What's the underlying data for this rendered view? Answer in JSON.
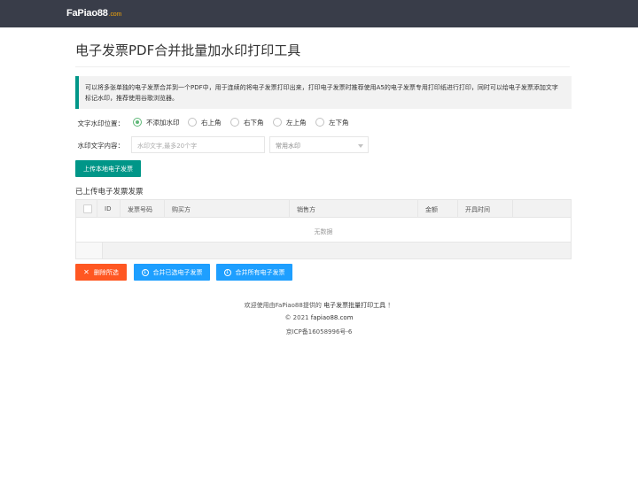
{
  "header": {
    "logo_main": "FaPiao88",
    "logo_domain": ".com"
  },
  "page": {
    "title": "电子发票PDF合并批量加水印打印工具"
  },
  "notice": {
    "text": "可以将多张单独的电子发票合并到一个PDF中，用于连续的将电子发票打印出来，打印电子发票时推荐使用A5的电子发票专用打印纸进行打印，同时可以给电子发票添加文字标记水印，推荐使用谷歌浏览器。"
  },
  "watermark_position": {
    "label": "文字水印位置：",
    "options": [
      {
        "label": "不添加水印",
        "selected": true
      },
      {
        "label": "右上角",
        "selected": false
      },
      {
        "label": "右下角",
        "selected": false
      },
      {
        "label": "左上角",
        "selected": false
      },
      {
        "label": "左下角",
        "selected": false
      }
    ]
  },
  "watermark_text": {
    "label": "水印文字内容：",
    "placeholder": "水印文字,最多20个字",
    "select_value": "常用水印"
  },
  "upload_button": "上传本地电子发票",
  "table": {
    "section_title": "已上传电子发票发票",
    "columns": [
      "ID",
      "发票号码",
      "购买方",
      "销售方",
      "金额",
      "开具时间"
    ],
    "empty_text": "无数据"
  },
  "actions": {
    "delete": "删除所选",
    "merge_selected": "合并已选电子发票",
    "merge_all": "合并所有电子发票"
  },
  "footer": {
    "line1_prefix": "欢迎使用由FaPiao88提供的",
    "line1_tool": "电子发票批量打印工具",
    "line1_suffix": "！",
    "copyright": "© 2021",
    "site": "fapiao88.com",
    "icp": "京ICP备16058996号-6"
  },
  "colors": {
    "topbar": "#393d49",
    "primary_green": "#009688",
    "danger": "#ff5722",
    "info_blue": "#1e9fff",
    "radio_checked": "#5fb878"
  }
}
